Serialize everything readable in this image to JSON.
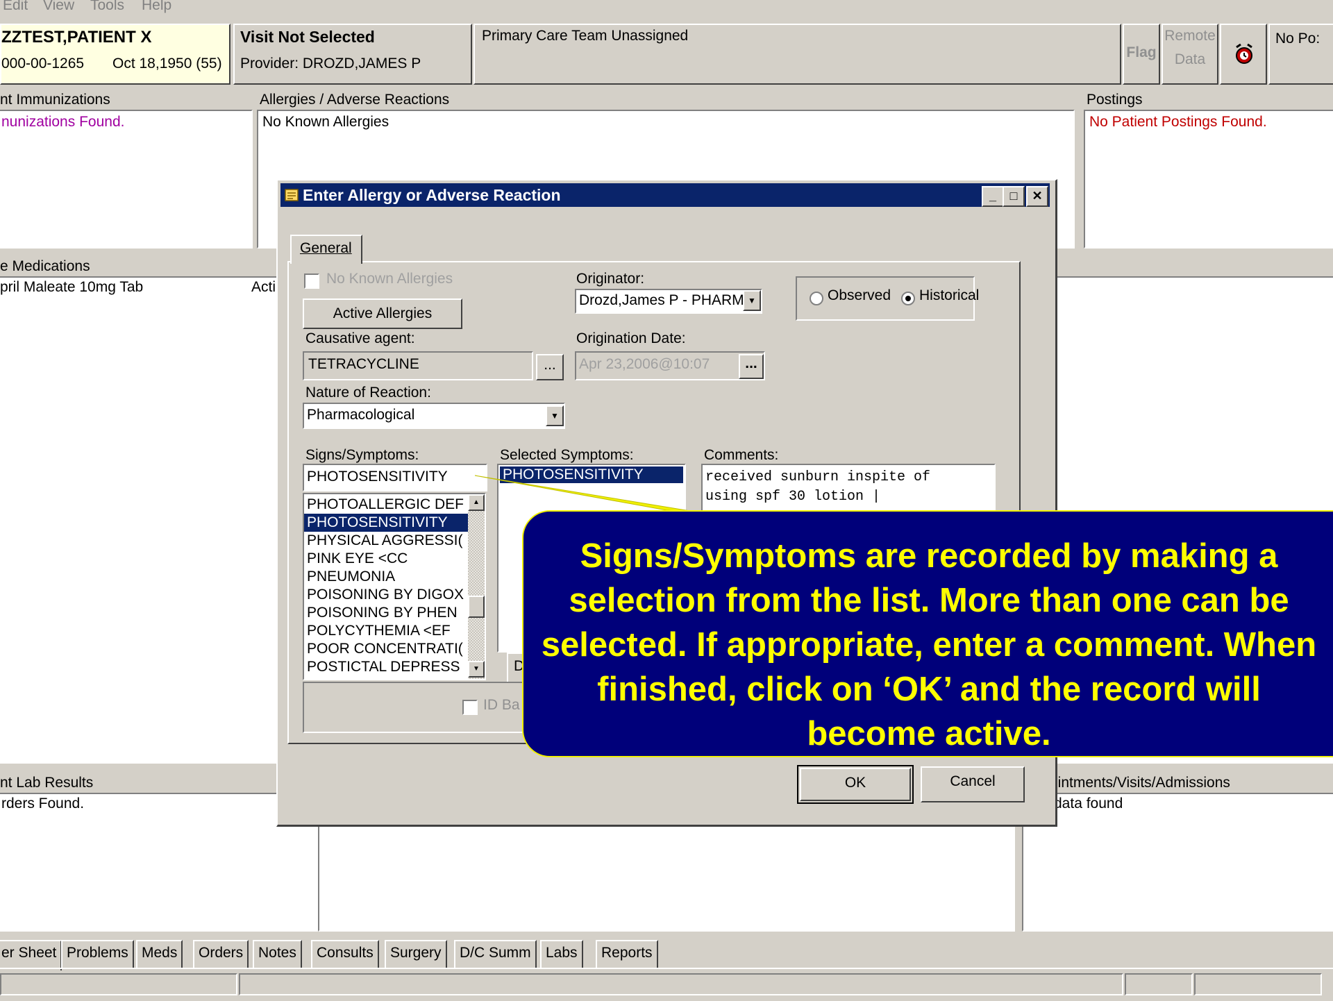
{
  "menu": [
    "Edit",
    "View",
    "Tools",
    "Help"
  ],
  "header": {
    "patient_name": "ZZTEST,PATIENT X",
    "patient_ssn": "000-00-1265",
    "patient_dob": "Oct 18,1950 (55)",
    "visit_title": "Visit Not Selected",
    "provider": "Provider:  DROZD,JAMES P",
    "team": "Primary Care Team Unassigned",
    "flag_label": "Flag",
    "remote_label_1": "Remote",
    "remote_label_2": "Data",
    "postings_btn": "No Po:"
  },
  "panels": {
    "immunizations_title": "nt Immunizations",
    "immunizations_item": "nunizations Found.",
    "allergies_title": "Allergies / Adverse Reactions",
    "allergies_item": "No Known Allergies",
    "postings_title": "Postings",
    "postings_item": "No Patient Postings Found.",
    "meds_title": "e Medications",
    "meds_item": "pril Maleate 10mg Tab",
    "meds_status": "Acti",
    "labs_title": "nt Lab Results",
    "labs_item": "rders Found.",
    "appts_title": "pintments/Visits/Admissions",
    "appts_item": "data found"
  },
  "dialog": {
    "title": "Enter Allergy or Adverse Reaction",
    "tab_general": "General",
    "no_known_allergies": "No Known Allergies",
    "active_allergies_btn": "Active Allergies",
    "originator_label": "Originator:",
    "originator_value": "Drozd,James P - PHARM",
    "observed_label": "Observed",
    "historical_label": "Historical",
    "causative_label": "Causative agent:",
    "causative_value": "TETRACYCLINE",
    "ellipsis": "...",
    "origination_date_label": "Origination Date:",
    "origination_date_value": "Apr 23,2006@10:07",
    "nature_label": "Nature of Reaction:",
    "nature_value": "Pharmacological",
    "signs_label": "Signs/Symptoms:",
    "signs_value": "PHOTOSENSITIVITY",
    "signs_list": [
      "PHOTOALLERGIC DEF",
      "PHOTOSENSITIVITY",
      "PHYSICAL AGGRESSI(",
      "PINK EYE          <CC",
      "PNEUMONIA",
      "POISONING BY DIGOX",
      "POISONING BY PHEN",
      "POLYCYTHEMIA   <EF",
      "POOR CONCENTRATI(",
      "POSTICTAL DEPRESS"
    ],
    "selected_symptoms_label": "Selected Symptoms:",
    "selected_symptoms": [
      "PHOTOSENSITIVITY"
    ],
    "comments_label": "Comments:",
    "comments_line1": "received sunburn inspite of",
    "comments_line2": "using spf 30 lotion |",
    "partial_btn": "D",
    "id_band_label": "ID Ba",
    "ok_btn": "OK",
    "cancel_btn": "Cancel"
  },
  "callout": {
    "text": "Signs/Symptoms are recorded by making a selection from the list. More than one can be selected. If appropriate, enter a comment. When finished, click on ‘OK’ and the record will become active."
  },
  "tabs": [
    "er Sheet",
    "Problems",
    "Meds",
    "Orders",
    "Notes",
    "Consults",
    "Surgery",
    "D/C Summ",
    "Labs",
    "Reports"
  ]
}
